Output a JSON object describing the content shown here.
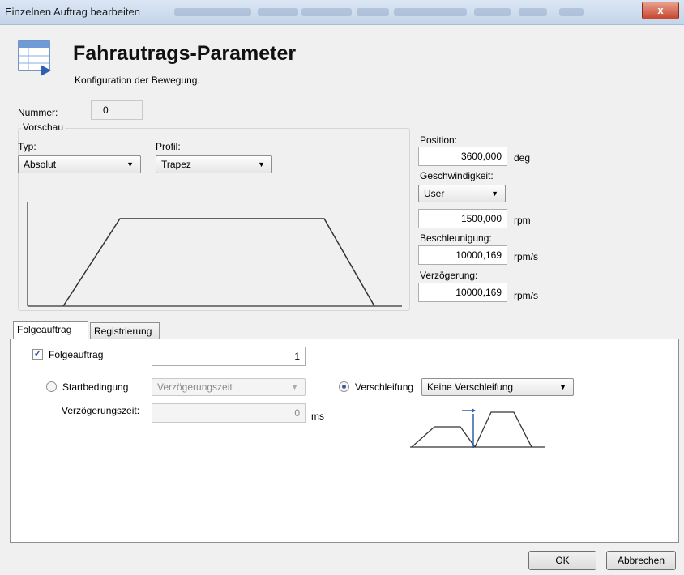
{
  "window": {
    "title": "Einzelnen Auftrag bearbeiten",
    "close_label": "x"
  },
  "header": {
    "title": "Fahrautrags-Parameter",
    "subtitle": "Konfiguration der Bewegung."
  },
  "nummer": {
    "label": "Nummer:",
    "value": "0"
  },
  "vorschau": {
    "caption": "Vorschau",
    "typ_label": "Typ:",
    "typ_value": "Absolut",
    "profil_label": "Profil:",
    "profil_value": "Trapez"
  },
  "params": {
    "position_label": "Position:",
    "position_value": "3600,000",
    "position_unit": "deg",
    "geschwindigkeit_label": "Geschwindigkeit:",
    "geschwindigkeit_mode": "User",
    "geschwindigkeit_value": "1500,000",
    "geschwindigkeit_unit": "rpm",
    "beschleunigung_label": "Beschleunigung:",
    "beschleunigung_value": "10000,169",
    "beschleunigung_unit": "rpm/s",
    "verzoegerung_label": "Verzögerung:",
    "verzoegerung_value": "10000,169",
    "verzoegerung_unit": "rpm/s"
  },
  "tabs": [
    {
      "label": "Folgeauftrag"
    },
    {
      "label": "Registrierung"
    }
  ],
  "folge": {
    "checkbox_label": "Folgeauftrag",
    "checkbox_mark": "✓",
    "value": "1",
    "start_label": "Startbedingung",
    "start_value": "Verzögerungszeit",
    "delay_label": "Verzögerungszeit:",
    "delay_value": "0",
    "delay_unit": "ms",
    "verschleifung_label": "Verschleifung",
    "verschleifung_value": "Keine Verschleifung"
  },
  "buttons": {
    "ok": "OK",
    "cancel": "Abbrechen"
  },
  "colors": {
    "accent": "#2f5fb3",
    "profile_line": "#333333"
  }
}
